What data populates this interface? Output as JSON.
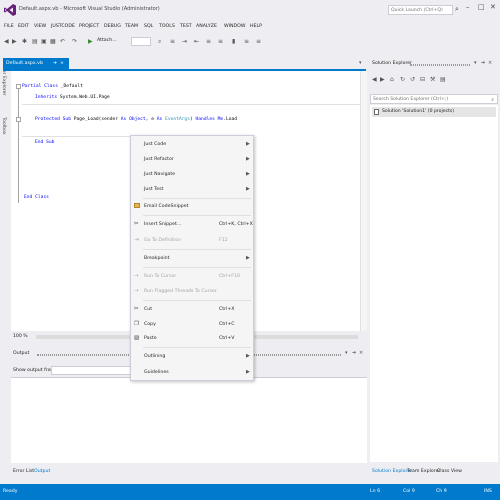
{
  "window": {
    "title": "Default.aspx.vb - Microsoft Visual Studio (Administrator)",
    "quick_launch_placeholder": "Quick Launch (Ctrl+Q)"
  },
  "menu": [
    "FILE",
    "EDIT",
    "VIEW",
    "JUSTCODE",
    "PROJECT",
    "DEBUG",
    "TEAM",
    "SQL",
    "TOOLS",
    "TEST",
    "ANALYZE",
    "WINDOW",
    "HELP"
  ],
  "toolbar": {
    "attach_label": "Attach..."
  },
  "left_tabs": [
    "Server Explorer",
    "Toolbox"
  ],
  "document_tab": {
    "label": "Default.aspx.vb",
    "pin": "➔",
    "close": "×"
  },
  "code": {
    "line1_kw": "Partial Class",
    "line1_name": " _Default",
    "line2_kw": "Inherits",
    "line2_rest": " System.Web.UI.Page",
    "line3_kw1": "Protected Sub",
    "line3_mid1": " Page_Load(sender ",
    "line3_kw2": "As Object",
    "line3_mid2": ", e ",
    "line3_kw3": "As",
    "line3_type": " EventArgs",
    "line3_mid3": ") ",
    "line3_kw4": "Handles Me",
    "line3_end": ".Load",
    "line4": "End Sub",
    "line5": "End Class"
  },
  "zoom": "100 %",
  "output": {
    "title": "Output",
    "show_output_from": "Show output from:"
  },
  "bottom_tabs": [
    {
      "label": "Error List",
      "active": false
    },
    {
      "label": "Output",
      "active": true
    }
  ],
  "solution_explorer": {
    "title": "Solution Explorer",
    "search_placeholder": "Search Solution Explorer (Ctrl+;)",
    "root_item": "Solution 'Solution1' (0 projects)",
    "bottom_tabs": [
      "Solution Explorer",
      "Team Explorer",
      "Class View"
    ]
  },
  "context_menu": {
    "items": [
      {
        "label": "Just Code",
        "submenu": true
      },
      {
        "label": "Just Refactor",
        "submenu": true
      },
      {
        "label": "Just Navigate",
        "submenu": true
      },
      {
        "label": "Just Test",
        "submenu": true
      },
      {
        "label": "Email CodeSnippet"
      },
      {
        "label": "Insert Snippet...",
        "shortcut": "Ctrl+K, Ctrl+X"
      },
      {
        "label": "Go To Definition",
        "shortcut": "F12",
        "disabled": true
      },
      {
        "label": "Breakpoint",
        "submenu": true
      },
      {
        "label": "Run To Cursor",
        "shortcut": "Ctrl+F10",
        "disabled": true
      },
      {
        "label": "Run Flagged Threads To Cursor",
        "disabled": true
      },
      {
        "label": "Cut",
        "shortcut": "Ctrl+X"
      },
      {
        "label": "Copy",
        "shortcut": "Ctrl+C"
      },
      {
        "label": "Paste",
        "shortcut": "Ctrl+V"
      },
      {
        "label": "Outlining",
        "submenu": true
      },
      {
        "label": "Guidelines",
        "submenu": true
      }
    ]
  },
  "status_bar": {
    "state": "Ready",
    "line": "Ln 6",
    "col": "Col 9",
    "ch": "Ch 9",
    "mode": "INS"
  },
  "colors": {
    "accent": "#007acc",
    "keyword": "#0000ff",
    "type": "#2b91af"
  }
}
